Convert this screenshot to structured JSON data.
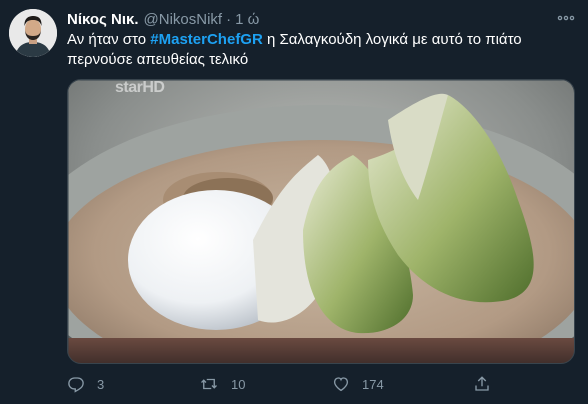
{
  "tweet": {
    "author": {
      "display_name": "Νίκος Νικ.",
      "handle": "@NikosNikf",
      "separator": "·",
      "timestamp": "1 ώ"
    },
    "text": {
      "line1_before": "Αν ήταν στο ",
      "hashtag": "#MasterChefGR",
      "line1_after": " η Σαλαγκούδη λογικά με αυτό το πιάτο",
      "line2": "περνούσε απευθείας τελικό"
    },
    "media": {
      "watermark": "starHD"
    },
    "actions": {
      "reply_count": "3",
      "retweet_count": "10",
      "like_count": "174"
    }
  },
  "icons": {
    "more": "more-icon",
    "reply": "reply-icon",
    "retweet": "retweet-icon",
    "like": "heart-icon",
    "share": "share-icon"
  },
  "colors": {
    "background": "#15202b",
    "text": "#ffffff",
    "secondary": "#8899a6",
    "hashtag": "#1da1f2"
  }
}
